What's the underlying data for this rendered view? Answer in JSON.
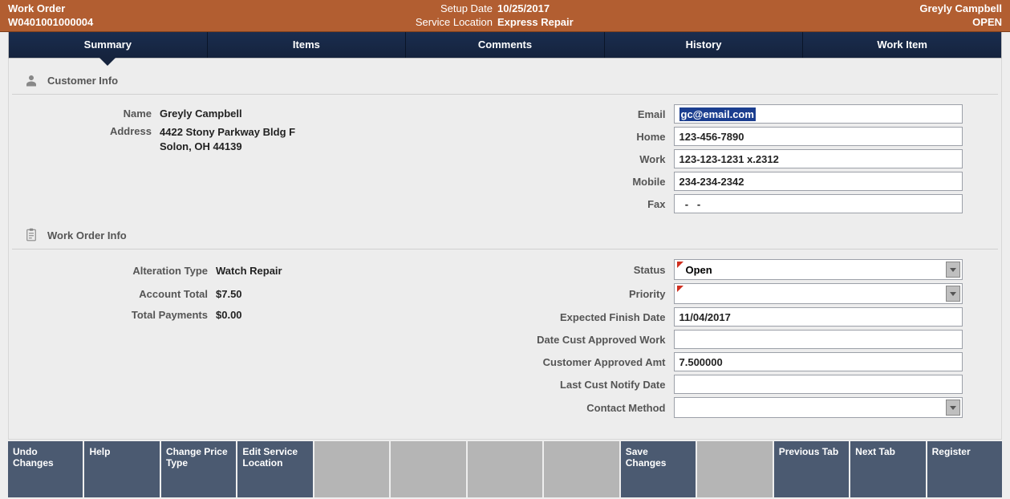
{
  "header": {
    "title": "Work Order",
    "order_number": "W0401001000004",
    "setup_date_label": "Setup Date",
    "setup_date": "10/25/2017",
    "service_location_label": "Service Location",
    "service_location": "Express Repair",
    "customer_name": "Greyly Campbell",
    "status": "OPEN"
  },
  "tabs": {
    "summary": "Summary",
    "items": "Items",
    "comments": "Comments",
    "history": "History",
    "work_item": "Work Item"
  },
  "customer_info": {
    "section_label": "Customer Info",
    "name_label": "Name",
    "name": "Greyly Campbell",
    "address_label": "Address",
    "address_line1": "4422 Stony Parkway Bldg F",
    "address_line2": "Solon, OH 44139",
    "email_label": "Email",
    "email": "gc@email.com",
    "home_label": "Home",
    "home": "123-456-7890",
    "work_label": "Work",
    "work": "123-123-1231 x.2312",
    "mobile_label": "Mobile",
    "mobile": "234-234-2342",
    "fax_label": "Fax",
    "fax": "  -   -"
  },
  "work_order_info": {
    "section_label": "Work Order Info",
    "alteration_type_label": "Alteration Type",
    "alteration_type": "Watch Repair",
    "account_total_label": "Account Total",
    "account_total": "$7.50",
    "total_payments_label": "Total Payments",
    "total_payments": "$0.00",
    "status_label": "Status",
    "status": "Open",
    "priority_label": "Priority",
    "priority": "",
    "expected_finish_label": "Expected Finish Date",
    "expected_finish": "11/04/2017",
    "date_cust_approved_label": "Date Cust Approved Work",
    "date_cust_approved": "",
    "cust_approved_amt_label": "Customer Approved Amt",
    "cust_approved_amt": "7.500000",
    "last_cust_notify_label": "Last Cust Notify Date",
    "last_cust_notify": "",
    "contact_method_label": "Contact Method",
    "contact_method": ""
  },
  "bottom_bar": {
    "undo": "Undo Changes",
    "help": "Help",
    "change_price_type": "Change Price Type",
    "edit_service_location": "Edit Service Location",
    "save_changes": "Save Changes",
    "previous_tab": "Previous Tab",
    "next_tab": "Next Tab",
    "register": "Register"
  }
}
